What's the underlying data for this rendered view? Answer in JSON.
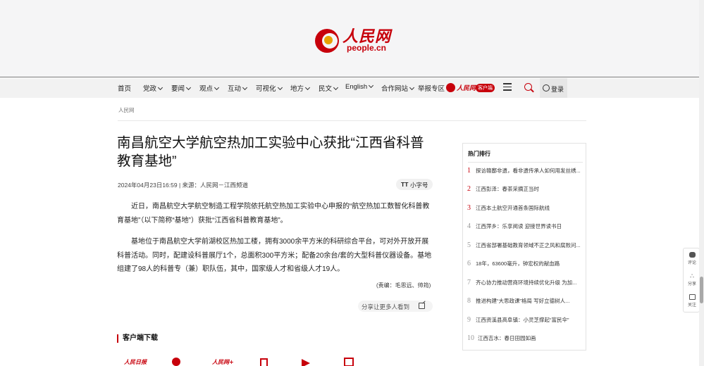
{
  "header": {
    "logo_cn": "人民网",
    "logo_en": "people.cn"
  },
  "nav": {
    "items": [
      {
        "label": "首页",
        "dropdown": false
      },
      {
        "label": "党政",
        "dropdown": true
      },
      {
        "label": "要闻",
        "dropdown": true
      },
      {
        "label": "观点",
        "dropdown": true
      },
      {
        "label": "互动",
        "dropdown": true
      },
      {
        "label": "可视化",
        "dropdown": true
      },
      {
        "label": "地方",
        "dropdown": true
      },
      {
        "label": "民文",
        "dropdown": true
      },
      {
        "label": "English",
        "dropdown": true
      },
      {
        "label": "合作网站",
        "dropdown": true
      },
      {
        "label": "举报专区",
        "dropdown": false
      }
    ],
    "app_brand": "人民网+",
    "app_badge": "客户端",
    "login_label": "登录"
  },
  "breadcrumb": "人民网",
  "article": {
    "title": "南昌航空大学航空热加工实验中心获批“江西省科普教育基地”",
    "meta": "2024年04月23日16:59 | 来源：人民网－江西频道",
    "font_toggle": "小字号",
    "font_toggle_icon": "TT",
    "paragraphs": [
      "近日，南昌航空大学航空制造工程学院依托航空热加工实验中心申报的“航空热加工数智化科普教育基地”（以下简称“基地”）获批“江西省科普教育基地”。",
      "基地位于南昌航空大学前湖校区热加工楼，拥有3000余平方米的科研综合平台，可对外开放开展科普活动。同时，配建设科普展厅1个，总面积300平方米；配备20余台/套的大型科普仪器设备。基地组建了98人的科普专（兼）职队伍，其中，国家级人才和省级人才19人。"
    ],
    "editor": "(责编：毛思远、帅筠)",
    "share_label": "分享让更多人看到"
  },
  "client_download": {
    "title": "客户端下载",
    "apps": [
      "人民日报",
      "人民网",
      "人民网+"
    ]
  },
  "hot": {
    "title": "热门排行",
    "items": [
      {
        "rank": "1",
        "text": "探访赣鄱非遗，看非遗传承人如何用发丝绣..."
      },
      {
        "rank": "2",
        "text": "江西彭泽：春茶采摘正当时"
      },
      {
        "rank": "3",
        "text": "江西本土航空开通首条国际航线"
      },
      {
        "rank": "4",
        "text": "江西萍乡：乐享阅读 迎接世界读书日"
      },
      {
        "rank": "5",
        "text": "江西省部署基础教育领域不正之风和腐败问..."
      },
      {
        "rank": "6",
        "text": "18年，63600毫升，钟宏权的献血路"
      },
      {
        "rank": "7",
        "text": "齐心协力推动营商环境持续优化升级 为加..."
      },
      {
        "rank": "8",
        "text": "推进构建“大思政课”格局 写好立德树人..."
      },
      {
        "rank": "9",
        "text": "江西资溪县高阜镇：小灵芝撑起“富民伞”"
      },
      {
        "rank": "10",
        "text": "江西吉水：春日田园如画"
      }
    ]
  },
  "float_bar": {
    "comment": "评论",
    "share": "分享",
    "follow": "关注"
  },
  "colors": {
    "brand_red": "#c7000b",
    "header_bg": "#f5f5f6"
  }
}
